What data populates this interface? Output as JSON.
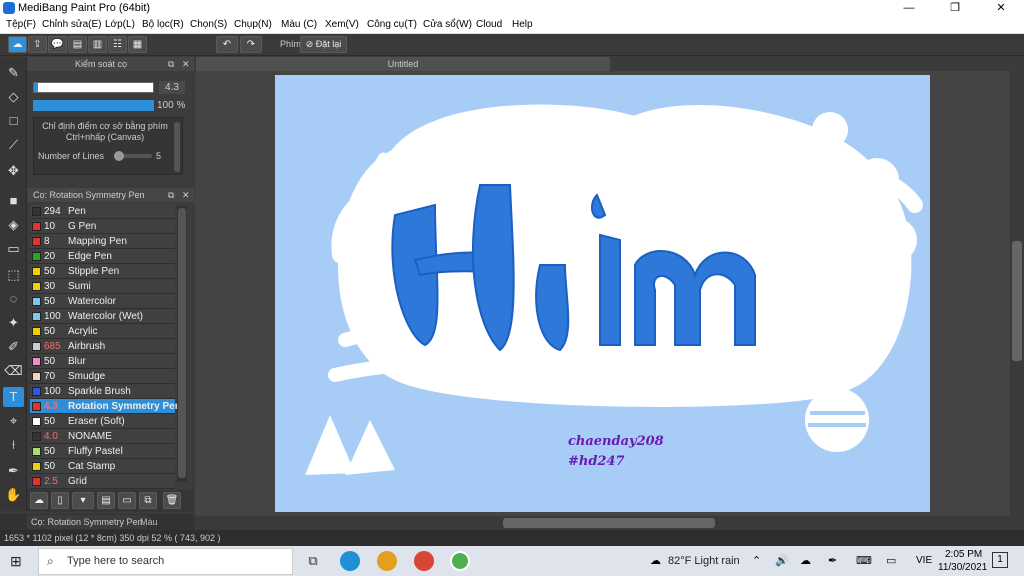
{
  "app": {
    "title": "MediBang Paint Pro (64bit)",
    "min": "—",
    "max": "❐",
    "close": "✕"
  },
  "menu": [
    "Tệp(F)",
    "Chỉnh sửa(E)",
    "Lớp(L)",
    "Bộ lọc(R)",
    "Chọn(S)",
    "Chụp(N)",
    "Màu (C)",
    "Xem(V)",
    "Công cụ(T)",
    "Cửa sổ(W)",
    "Cloud",
    "Help"
  ],
  "toolbar": {
    "hotkey_label": "Phím",
    "reset_label": "Đặt lại"
  },
  "brush_control": {
    "title": "Kiểm soát cọ",
    "size_value": "4.3",
    "opacity_value": "100 %",
    "hint": "Chỉ định điểm cơ sở bằng phím Ctrl+nhấp (Canvas)",
    "lines_label": "Number of Lines",
    "lines_value": "5",
    "size_fraction": 0.03,
    "opacity_fraction": 1.0
  },
  "brush_panel": {
    "title": "Cọ: Rotation Symmetry Pen"
  },
  "brushes": [
    {
      "size": "294",
      "name": "Pen",
      "color": "#333333"
    },
    {
      "size": "10",
      "name": "G Pen",
      "color": "#e8312c"
    },
    {
      "size": "8",
      "name": "Mapping Pen",
      "color": "#e8312c"
    },
    {
      "size": "20",
      "name": "Edge Pen",
      "color": "#22aa22"
    },
    {
      "size": "50",
      "name": "Stipple Pen",
      "color": "#f0d000"
    },
    {
      "size": "30",
      "name": "Sumi",
      "color": "#f0d000"
    },
    {
      "size": "50",
      "name": "Watercolor",
      "color": "#7ec8f0"
    },
    {
      "size": "100",
      "name": "Watercolor (Wet)",
      "color": "#7ec8f0"
    },
    {
      "size": "50",
      "name": "Acrylic",
      "color": "#f0d000"
    },
    {
      "size": "685",
      "name": "Airbrush",
      "color": "#cccccc"
    },
    {
      "size": "50",
      "name": "Blur",
      "color": "#f08ac8"
    },
    {
      "size": "70",
      "name": "Smudge",
      "color": "#f6d6b8"
    },
    {
      "size": "100",
      "name": "Sparkle Brush",
      "color": "#2a5ae0"
    },
    {
      "size": "4.3",
      "name": "Rotation Symmetry Pen",
      "color": "#e8312c",
      "selected": true
    },
    {
      "size": "50",
      "name": "Eraser (Soft)",
      "color": "#ffffff"
    },
    {
      "size": "4.0",
      "name": "NONAME",
      "color": "#333333"
    },
    {
      "size": "50",
      "name": "Fluffy Pastel",
      "color": "#a8e070"
    },
    {
      "size": "50",
      "name": "Cat Stamp",
      "color": "#f0d000"
    },
    {
      "size": "2.5",
      "name": "Grid",
      "color": "#e8312c"
    }
  ],
  "bottom_tabs": {
    "active": "Cọ: Rotation Symmetry Pen",
    "other": "Màu"
  },
  "document": {
    "tab_title": "Untitled",
    "art_title": "Hiim",
    "signature": "chaenday208",
    "hashtag": "#hd247"
  },
  "status": {
    "text": "1653 * 1102 pixel   (12 * 8cm)   350 dpi   52 %   ( 743, 902 )"
  },
  "taskbar": {
    "search_placeholder": "Type here to search",
    "weather": "82°F  Light rain",
    "lang": "VIE",
    "time": "2:05 PM",
    "date": "11/30/2021",
    "notif": "1"
  },
  "colors": {
    "accent": "#2e8fd8",
    "canvas_bg": "#a7cdf7",
    "letter": "#1f7be0"
  }
}
